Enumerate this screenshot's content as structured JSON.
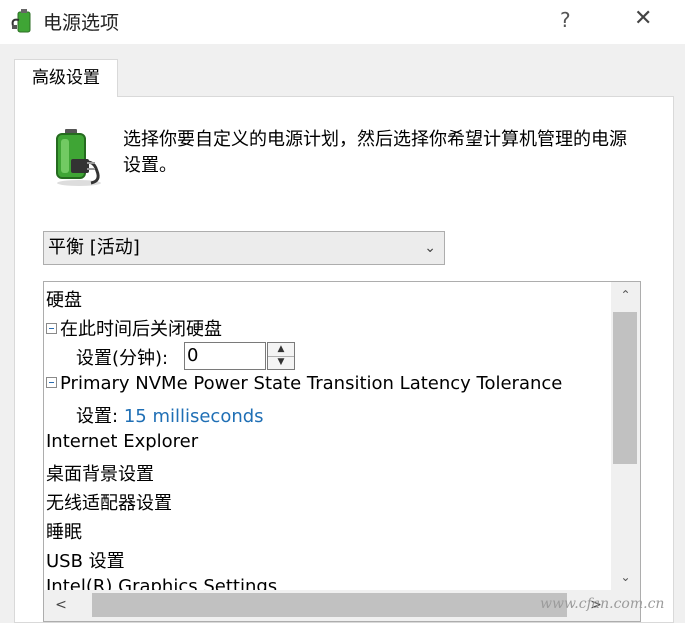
{
  "window": {
    "title": "电源选项",
    "help_label": "?",
    "close_label": "✕"
  },
  "tab": {
    "label": "高级设置"
  },
  "description": "选择你要自定义的电源计划，然后选择你希望计算机管理的电源设置。",
  "plan": {
    "selected": "平衡 [活动]"
  },
  "tree": {
    "items": [
      {
        "label": "硬盘"
      },
      {
        "label": "在此时间后关闭硬盘"
      },
      {
        "label": "设置(分钟):",
        "value": "0"
      },
      {
        "label": "Primary NVMe Power State Transition Latency Tolerance"
      },
      {
        "label": "设置:",
        "value": "15 milliseconds"
      },
      {
        "label": "Internet Explorer"
      },
      {
        "label": "桌面背景设置"
      },
      {
        "label": "无线适配器设置"
      },
      {
        "label": "睡眠"
      },
      {
        "label": "USB 设置"
      },
      {
        "label": "Intel(R) Graphics Settings"
      }
    ]
  },
  "watermark": "www.cfan.com.cn",
  "colors": {
    "link": "#1f6fb5",
    "battery_green": "#3fa535"
  },
  "icons": {
    "app": "power-options-icon",
    "battery": "battery-plug-icon"
  }
}
